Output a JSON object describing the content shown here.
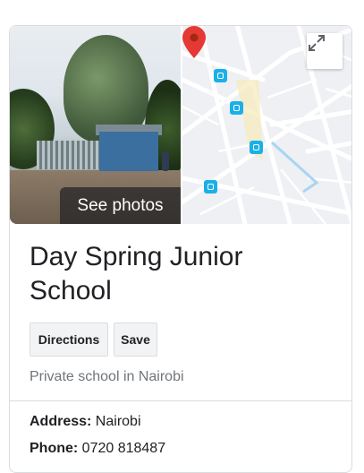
{
  "photo": {
    "button_label": "See photos"
  },
  "map": {
    "expand_icon": "expand-icon",
    "pin_color": "#e53935",
    "bus_color": "#1ab0e8"
  },
  "place": {
    "name": "Day Spring Junior School",
    "type": "Private school in Nairobi"
  },
  "actions": {
    "directions": "Directions",
    "save": "Save"
  },
  "details": [
    {
      "label": "Address:",
      "value": " Nairobi"
    },
    {
      "label": "Phone:",
      "value": " 0720 818487"
    }
  ]
}
